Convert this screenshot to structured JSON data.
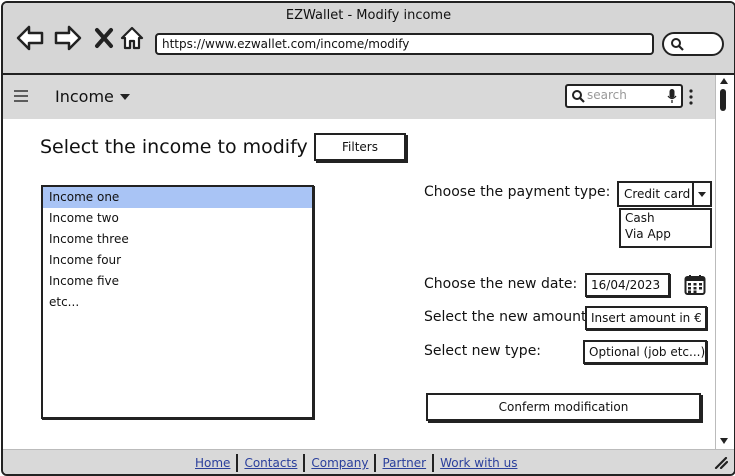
{
  "window": {
    "title": "EZWallet - Modify income",
    "url": "https://www.ezwallet.com/income/modify"
  },
  "app_header": {
    "title": "Income",
    "search_placeholder": "search"
  },
  "main": {
    "heading": "Select the income to modify",
    "filters_label": "Filters",
    "income_list": [
      {
        "label": "Income one",
        "selected": true
      },
      {
        "label": "Income two",
        "selected": false
      },
      {
        "label": "Income three",
        "selected": false
      },
      {
        "label": "Income four",
        "selected": false
      },
      {
        "label": "Income five",
        "selected": false
      },
      {
        "label": "etc...",
        "selected": false
      }
    ],
    "form": {
      "payment_type_label": "Choose the payment type:",
      "payment_type_selected": "Credit card",
      "payment_type_options": [
        "Cash",
        "Via App"
      ],
      "date_label": "Choose the new date:",
      "date_value": "16/04/2023",
      "amount_label": "Select the new amount:",
      "amount_value": "Insert amount in €",
      "type_label": "Select new type:",
      "type_value": "Optional (job etc...)",
      "confirm_label": "Conferm modification"
    }
  },
  "footer": {
    "links": [
      "Home",
      "Contacts",
      "Company",
      "Partner",
      "Work with us"
    ]
  },
  "colors": {
    "selected_row": "#a9c4f5",
    "chrome_bg": "#d6d6d6",
    "link": "#2a3f9c"
  }
}
